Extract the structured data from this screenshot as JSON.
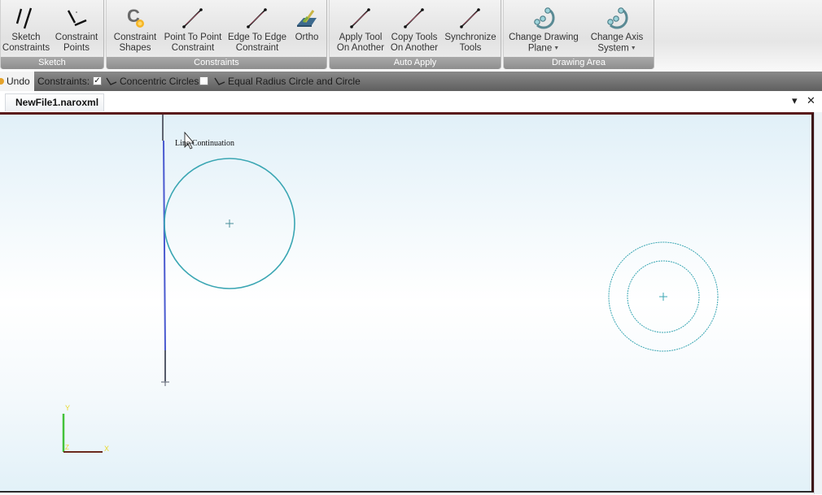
{
  "ribbon": {
    "groups": [
      {
        "label": "Sketch",
        "tools": [
          {
            "label": "Sketch\nConstraints",
            "icon": "sketch-lines-icon"
          },
          {
            "label": "Constraint\nPoints",
            "icon": "constraint-points-icon"
          }
        ]
      },
      {
        "label": "Constraints",
        "tools": [
          {
            "label": "Constraint\nShapes",
            "icon": "constraint-shapes-icon"
          },
          {
            "label": "Point To Point\nConstraint",
            "icon": "line-segment-icon"
          },
          {
            "label": "Edge To Edge\nConstraint",
            "icon": "line-segment-icon"
          },
          {
            "label": "Ortho",
            "icon": "ortho-icon"
          }
        ]
      },
      {
        "label": "Auto Apply",
        "tools": [
          {
            "label": "Apply Tool\nOn Another",
            "icon": "line-segment-icon"
          },
          {
            "label": "Copy Tools\nOn Another",
            "icon": "line-segment-icon"
          },
          {
            "label": "Synchronize\nTools",
            "icon": "line-segment-icon"
          }
        ]
      },
      {
        "label": "Drawing Area",
        "tools": [
          {
            "label": "Change Drawing\nPlane",
            "icon": "drawing-plane-icon",
            "dropdown": true
          },
          {
            "label": "Change Axis\nSystem",
            "icon": "axis-system-icon",
            "dropdown": true
          }
        ]
      }
    ]
  },
  "constraint_bar": {
    "undo_label": "Undo",
    "constraints_label": "Constraints:",
    "items": [
      {
        "label": "Concentric Circles",
        "checked": true
      },
      {
        "label": "Equal Radius Circle and Circle",
        "checked": false
      }
    ]
  },
  "tabs": {
    "active": "NewFile1.naroxml",
    "pin_icon": "▾",
    "close_icon": "✕"
  },
  "canvas": {
    "hint": "Line Continuation",
    "axes": {
      "x_label": "X",
      "y_label": "Y",
      "z_label": "Z"
    },
    "colors": {
      "circle": "#3aa6b3",
      "line": "#4a5ad0",
      "line_dark": "#555b6a",
      "axis_x": "#6b2a1e",
      "axis_y": "#44c23a",
      "axis_label": "#f2e64a"
    }
  }
}
